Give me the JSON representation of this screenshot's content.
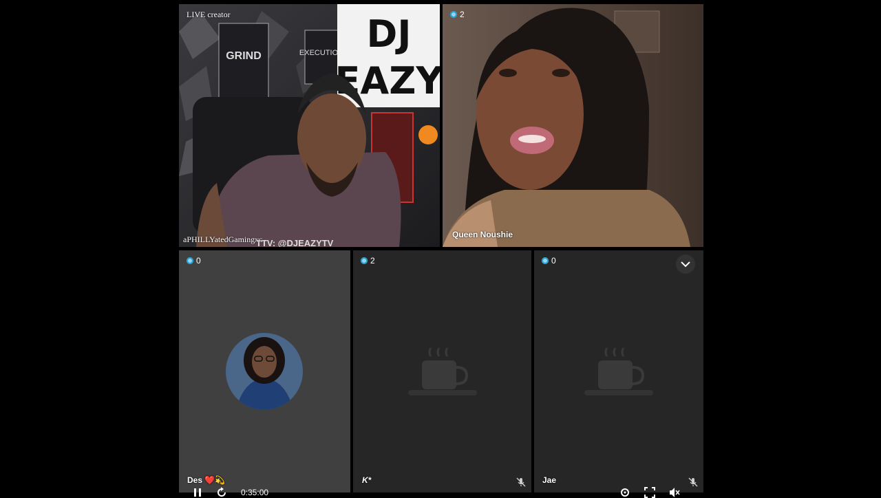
{
  "host_tile": {
    "label": "LIVE creator",
    "username": "aPHILLYatedGaming",
    "username_suffix": "NG",
    "overlay_text": "TTV: @DJEAZYTV",
    "wall_signs": [
      "GRIND",
      "EXECUTION",
      "DJ",
      "EAZY"
    ]
  },
  "queen_tile": {
    "viewers": "2",
    "name": "Queen Noushie"
  },
  "guest_tiles": [
    {
      "viewers": "0",
      "name": "Des ❤️💫",
      "state": "avatar",
      "muted": false
    },
    {
      "viewers": "2",
      "name": "K*",
      "state": "away-cup-icon",
      "muted": true
    },
    {
      "viewers": "0",
      "name": "Jae",
      "state": "away-cup-icon",
      "muted": true
    }
  ],
  "player": {
    "time": "0:35:00"
  },
  "colors": {
    "viewer_dot": "#8fd8f0",
    "tile_dark": "#262626",
    "tile_mid": "#404040"
  }
}
